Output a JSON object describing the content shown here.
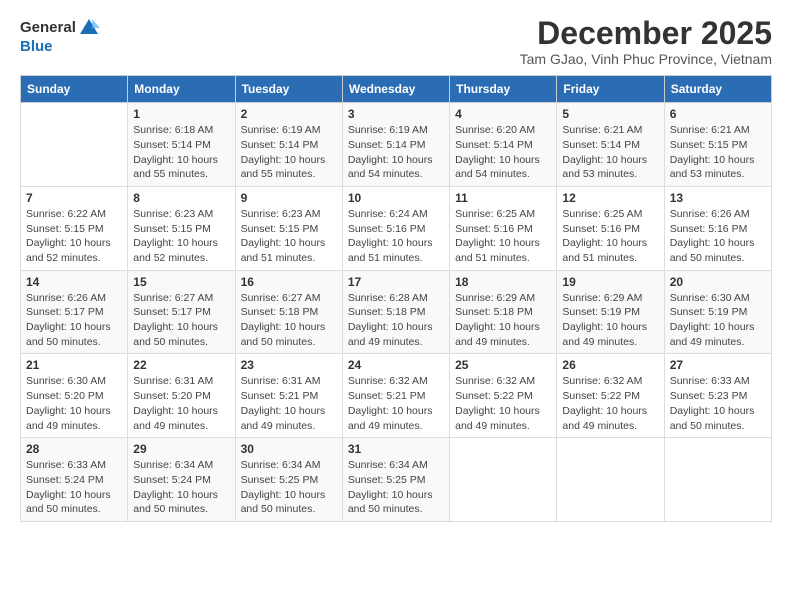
{
  "logo": {
    "general": "General",
    "blue": "Blue"
  },
  "header": {
    "month": "December 2025",
    "location": "Tam GJao, Vinh Phuc Province, Vietnam"
  },
  "weekdays": [
    "Sunday",
    "Monday",
    "Tuesday",
    "Wednesday",
    "Thursday",
    "Friday",
    "Saturday"
  ],
  "weeks": [
    [
      {
        "day": "",
        "sunrise": "",
        "sunset": "",
        "daylight": ""
      },
      {
        "day": "1",
        "sunrise": "Sunrise: 6:18 AM",
        "sunset": "Sunset: 5:14 PM",
        "daylight": "Daylight: 10 hours and 55 minutes."
      },
      {
        "day": "2",
        "sunrise": "Sunrise: 6:19 AM",
        "sunset": "Sunset: 5:14 PM",
        "daylight": "Daylight: 10 hours and 55 minutes."
      },
      {
        "day": "3",
        "sunrise": "Sunrise: 6:19 AM",
        "sunset": "Sunset: 5:14 PM",
        "daylight": "Daylight: 10 hours and 54 minutes."
      },
      {
        "day": "4",
        "sunrise": "Sunrise: 6:20 AM",
        "sunset": "Sunset: 5:14 PM",
        "daylight": "Daylight: 10 hours and 54 minutes."
      },
      {
        "day": "5",
        "sunrise": "Sunrise: 6:21 AM",
        "sunset": "Sunset: 5:14 PM",
        "daylight": "Daylight: 10 hours and 53 minutes."
      },
      {
        "day": "6",
        "sunrise": "Sunrise: 6:21 AM",
        "sunset": "Sunset: 5:15 PM",
        "daylight": "Daylight: 10 hours and 53 minutes."
      }
    ],
    [
      {
        "day": "7",
        "sunrise": "Sunrise: 6:22 AM",
        "sunset": "Sunset: 5:15 PM",
        "daylight": "Daylight: 10 hours and 52 minutes."
      },
      {
        "day": "8",
        "sunrise": "Sunrise: 6:23 AM",
        "sunset": "Sunset: 5:15 PM",
        "daylight": "Daylight: 10 hours and 52 minutes."
      },
      {
        "day": "9",
        "sunrise": "Sunrise: 6:23 AM",
        "sunset": "Sunset: 5:15 PM",
        "daylight": "Daylight: 10 hours and 51 minutes."
      },
      {
        "day": "10",
        "sunrise": "Sunrise: 6:24 AM",
        "sunset": "Sunset: 5:16 PM",
        "daylight": "Daylight: 10 hours and 51 minutes."
      },
      {
        "day": "11",
        "sunrise": "Sunrise: 6:25 AM",
        "sunset": "Sunset: 5:16 PM",
        "daylight": "Daylight: 10 hours and 51 minutes."
      },
      {
        "day": "12",
        "sunrise": "Sunrise: 6:25 AM",
        "sunset": "Sunset: 5:16 PM",
        "daylight": "Daylight: 10 hours and 51 minutes."
      },
      {
        "day": "13",
        "sunrise": "Sunrise: 6:26 AM",
        "sunset": "Sunset: 5:16 PM",
        "daylight": "Daylight: 10 hours and 50 minutes."
      }
    ],
    [
      {
        "day": "14",
        "sunrise": "Sunrise: 6:26 AM",
        "sunset": "Sunset: 5:17 PM",
        "daylight": "Daylight: 10 hours and 50 minutes."
      },
      {
        "day": "15",
        "sunrise": "Sunrise: 6:27 AM",
        "sunset": "Sunset: 5:17 PM",
        "daylight": "Daylight: 10 hours and 50 minutes."
      },
      {
        "day": "16",
        "sunrise": "Sunrise: 6:27 AM",
        "sunset": "Sunset: 5:18 PM",
        "daylight": "Daylight: 10 hours and 50 minutes."
      },
      {
        "day": "17",
        "sunrise": "Sunrise: 6:28 AM",
        "sunset": "Sunset: 5:18 PM",
        "daylight": "Daylight: 10 hours and 49 minutes."
      },
      {
        "day": "18",
        "sunrise": "Sunrise: 6:29 AM",
        "sunset": "Sunset: 5:18 PM",
        "daylight": "Daylight: 10 hours and 49 minutes."
      },
      {
        "day": "19",
        "sunrise": "Sunrise: 6:29 AM",
        "sunset": "Sunset: 5:19 PM",
        "daylight": "Daylight: 10 hours and 49 minutes."
      },
      {
        "day": "20",
        "sunrise": "Sunrise: 6:30 AM",
        "sunset": "Sunset: 5:19 PM",
        "daylight": "Daylight: 10 hours and 49 minutes."
      }
    ],
    [
      {
        "day": "21",
        "sunrise": "Sunrise: 6:30 AM",
        "sunset": "Sunset: 5:20 PM",
        "daylight": "Daylight: 10 hours and 49 minutes."
      },
      {
        "day": "22",
        "sunrise": "Sunrise: 6:31 AM",
        "sunset": "Sunset: 5:20 PM",
        "daylight": "Daylight: 10 hours and 49 minutes."
      },
      {
        "day": "23",
        "sunrise": "Sunrise: 6:31 AM",
        "sunset": "Sunset: 5:21 PM",
        "daylight": "Daylight: 10 hours and 49 minutes."
      },
      {
        "day": "24",
        "sunrise": "Sunrise: 6:32 AM",
        "sunset": "Sunset: 5:21 PM",
        "daylight": "Daylight: 10 hours and 49 minutes."
      },
      {
        "day": "25",
        "sunrise": "Sunrise: 6:32 AM",
        "sunset": "Sunset: 5:22 PM",
        "daylight": "Daylight: 10 hours and 49 minutes."
      },
      {
        "day": "26",
        "sunrise": "Sunrise: 6:32 AM",
        "sunset": "Sunset: 5:22 PM",
        "daylight": "Daylight: 10 hours and 49 minutes."
      },
      {
        "day": "27",
        "sunrise": "Sunrise: 6:33 AM",
        "sunset": "Sunset: 5:23 PM",
        "daylight": "Daylight: 10 hours and 50 minutes."
      }
    ],
    [
      {
        "day": "28",
        "sunrise": "Sunrise: 6:33 AM",
        "sunset": "Sunset: 5:24 PM",
        "daylight": "Daylight: 10 hours and 50 minutes."
      },
      {
        "day": "29",
        "sunrise": "Sunrise: 6:34 AM",
        "sunset": "Sunset: 5:24 PM",
        "daylight": "Daylight: 10 hours and 50 minutes."
      },
      {
        "day": "30",
        "sunrise": "Sunrise: 6:34 AM",
        "sunset": "Sunset: 5:25 PM",
        "daylight": "Daylight: 10 hours and 50 minutes."
      },
      {
        "day": "31",
        "sunrise": "Sunrise: 6:34 AM",
        "sunset": "Sunset: 5:25 PM",
        "daylight": "Daylight: 10 hours and 50 minutes."
      },
      {
        "day": "",
        "sunrise": "",
        "sunset": "",
        "daylight": ""
      },
      {
        "day": "",
        "sunrise": "",
        "sunset": "",
        "daylight": ""
      },
      {
        "day": "",
        "sunrise": "",
        "sunset": "",
        "daylight": ""
      }
    ]
  ]
}
